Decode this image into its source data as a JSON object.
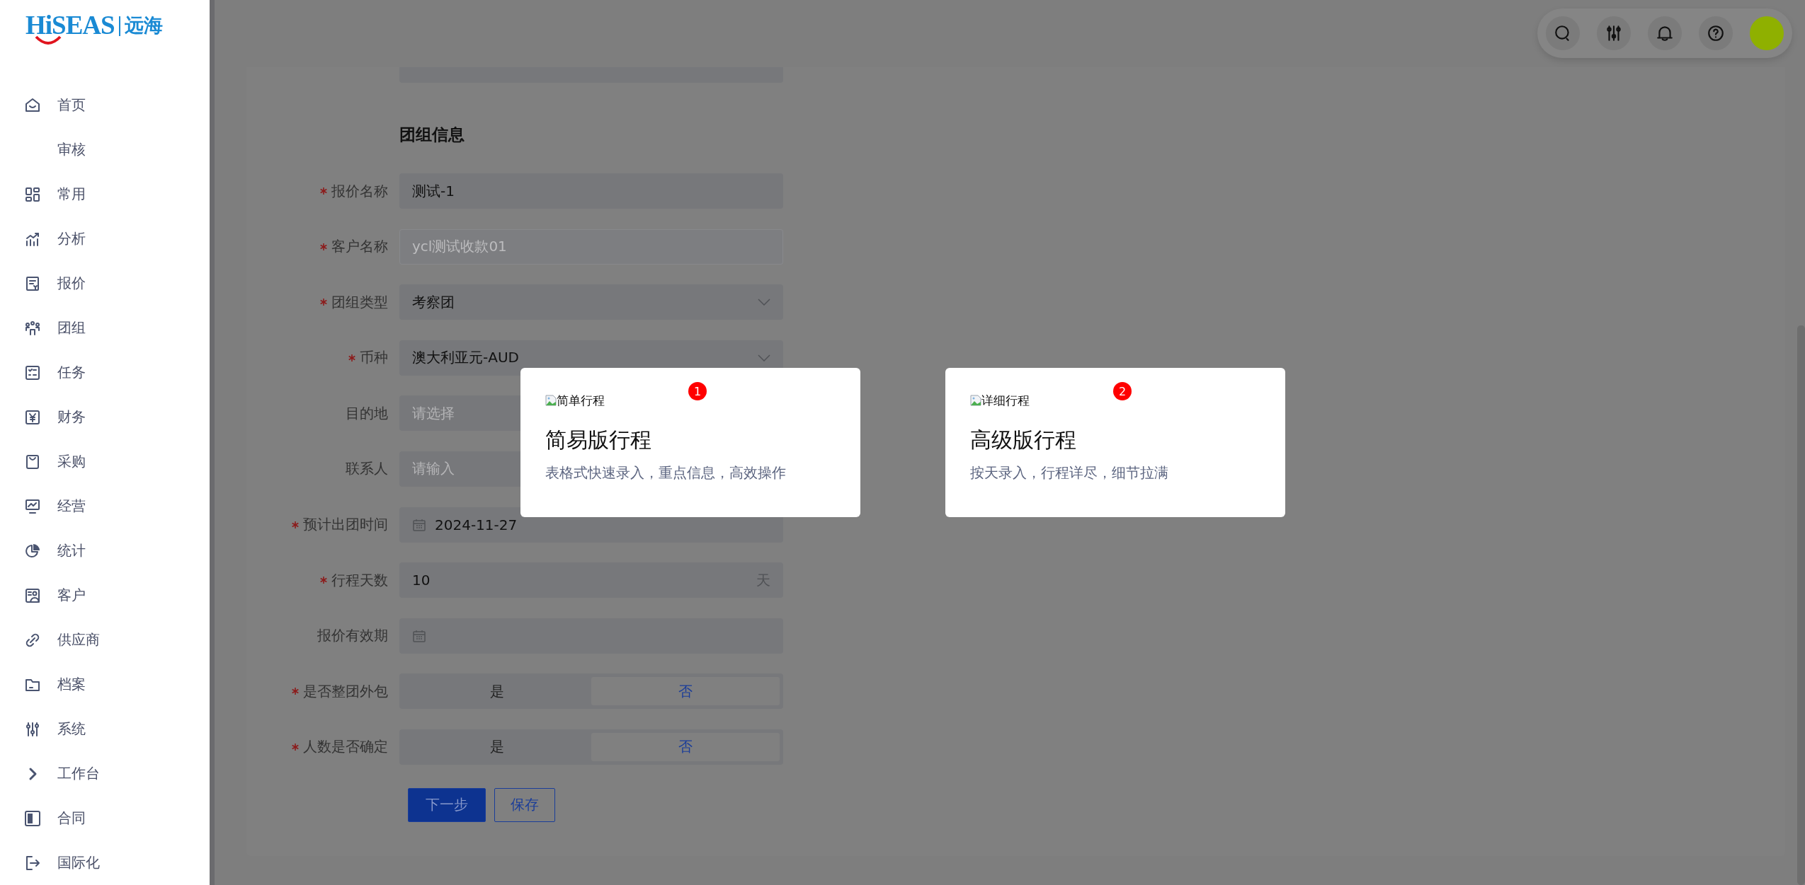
{
  "logo": {
    "brand": "HiSEAS",
    "name": "远海"
  },
  "sidebar": {
    "items": [
      {
        "label": "首页"
      },
      {
        "label": "审核"
      },
      {
        "label": "常用"
      },
      {
        "label": "分析"
      },
      {
        "label": "报价"
      },
      {
        "label": "团组"
      },
      {
        "label": "任务"
      },
      {
        "label": "财务"
      },
      {
        "label": "采购"
      },
      {
        "label": "经营"
      },
      {
        "label": "统计"
      },
      {
        "label": "客户"
      },
      {
        "label": "供应商"
      },
      {
        "label": "档案"
      },
      {
        "label": "系统"
      },
      {
        "label": "工作台"
      },
      {
        "label": "合同"
      },
      {
        "label": "国际化"
      }
    ]
  },
  "form": {
    "section_title": "团组信息",
    "fields": [
      {
        "label": "报价名称",
        "required": true,
        "kind": "input",
        "value": "测试-1",
        "disabled": false
      },
      {
        "label": "客户名称",
        "required": true,
        "kind": "input",
        "value": "ycl测试收款01",
        "disabled": true
      },
      {
        "label": "团组类型",
        "required": true,
        "kind": "select",
        "value": "考察团",
        "disabled": false
      },
      {
        "label": "币种",
        "required": true,
        "kind": "select",
        "value": "澳大利亚元-AUD",
        "disabled": false
      },
      {
        "label": "目的地",
        "required": false,
        "kind": "select",
        "placeholder": "请选择",
        "disabled": false
      },
      {
        "label": "联系人",
        "required": false,
        "kind": "input",
        "placeholder": "请输入",
        "disabled": false
      },
      {
        "label": "预计出团时间",
        "required": true,
        "kind": "date",
        "value": "2024-11-27",
        "disabled": false
      },
      {
        "label": "行程天数",
        "required": true,
        "kind": "number",
        "value": "10",
        "suffix": "天",
        "disabled": false
      },
      {
        "label": "报价有效期",
        "required": false,
        "kind": "date",
        "disabled": false
      },
      {
        "label": "是否整团外包",
        "required": true,
        "kind": "segmented",
        "disabled": false,
        "options": [
          {
            "label": "是",
            "selected": false
          },
          {
            "label": "否",
            "selected": true
          }
        ]
      },
      {
        "label": "人数是否确定",
        "required": true,
        "kind": "segmented",
        "disabled": false,
        "options": [
          {
            "label": "是",
            "selected": false
          },
          {
            "label": "否",
            "selected": true
          }
        ]
      }
    ],
    "buttons": [
      {
        "label": "下一步",
        "kind": "primary"
      },
      {
        "label": "保存",
        "kind": "default"
      }
    ]
  },
  "itinerary_options": [
    {
      "image_alt": "简单行程",
      "title": "简易版行程",
      "description": "表格式快速录入，重点信息，高效操作",
      "badge": "1"
    },
    {
      "image_alt": "详细行程",
      "title": "高级版行程",
      "description": "按天录入，行程详尽，细节拉满",
      "badge": "2"
    }
  ]
}
